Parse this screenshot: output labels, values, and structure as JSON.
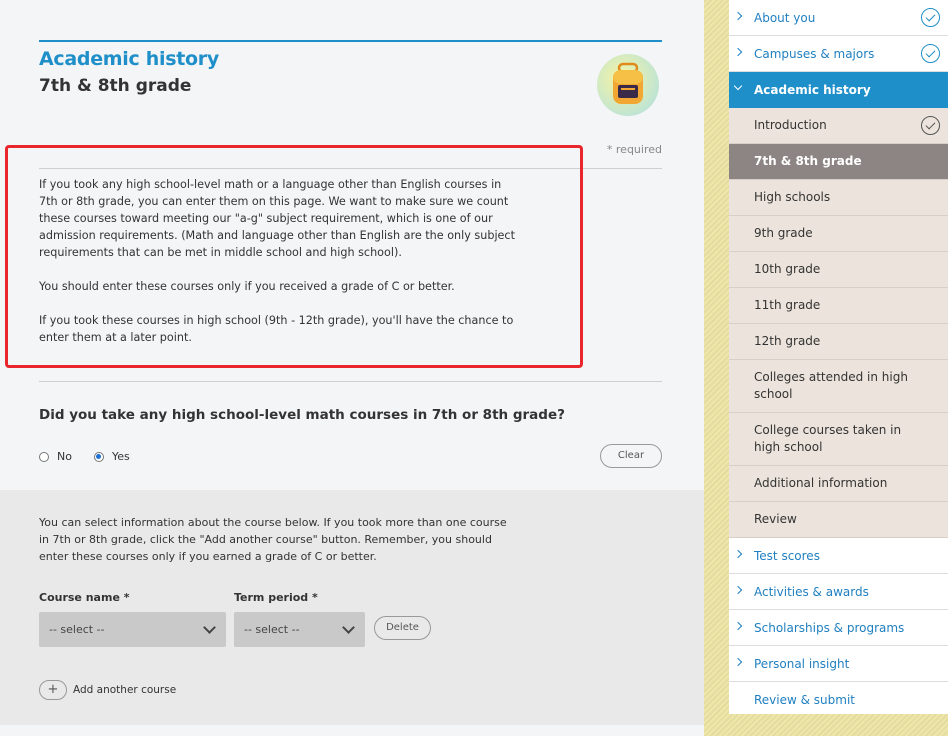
{
  "header": {
    "title": "Academic history",
    "subtitle": "7th & 8th grade",
    "required_note": "* required",
    "icon": "backpack-icon"
  },
  "intro": {
    "paragraphs": [
      "If you took any high school-level math or a language other than English courses in 7th or 8th grade, you can enter them on this page. We want to make sure we count these courses toward meeting our \"a-g\" subject requirement, which is one of our admission requirements. (Math and language other than English are the only subject requirements that can be met in middle school and high school).",
      "You should enter these courses only if you received a grade of C or better.",
      "If you took these courses in high school (9th - 12th grade), you'll have the chance to enter them at a later point."
    ]
  },
  "question": {
    "text": "Did you take any high school-level math courses in 7th or 8th grade?",
    "options": [
      "No",
      "Yes"
    ],
    "selected": "Yes",
    "clear_label": "Clear"
  },
  "course": {
    "info": "You can select information about the course below. If you took more than one course in 7th or 8th grade, click the \"Add another course\" button. Remember, you should enter these courses only if you earned a grade of C or better.",
    "course_name_label": "Course name *",
    "course_name_value": "-- select --",
    "term_label": "Term period *",
    "term_value": "-- select --",
    "delete_label": "Delete",
    "add_label": "Add another course",
    "add_symbol": "+"
  },
  "sidebar": {
    "items": [
      {
        "label": "About you",
        "checked": true
      },
      {
        "label": "Campuses & majors",
        "checked": true
      },
      {
        "label": "Academic history",
        "active": true
      }
    ],
    "subitems": [
      {
        "label": "Introduction",
        "checked": true
      },
      {
        "label": "7th & 8th grade",
        "current": true
      },
      {
        "label": "High schools"
      },
      {
        "label": "9th grade"
      },
      {
        "label": "10th grade"
      },
      {
        "label": "11th grade"
      },
      {
        "label": "12th grade"
      },
      {
        "label": "Colleges attended in high school"
      },
      {
        "label": "College courses taken in high school"
      },
      {
        "label": "Additional information"
      },
      {
        "label": "Review"
      }
    ],
    "items_after": [
      {
        "label": "Test scores"
      },
      {
        "label": "Activities & awards"
      },
      {
        "label": "Scholarships & programs"
      },
      {
        "label": "Personal insight"
      },
      {
        "label": "Review & submit"
      }
    ]
  },
  "colors": {
    "accent": "#1f8fc9",
    "highlight": "#e8262b",
    "current_bg": "#8d8583"
  }
}
